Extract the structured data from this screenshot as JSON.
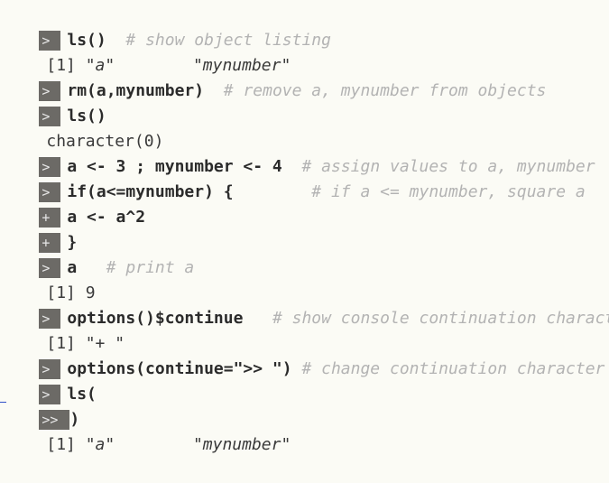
{
  "console": {
    "lines": [
      {
        "prompt": ">",
        "code": "ls()",
        "comment": "# show object listing"
      },
      {
        "output_parts": [
          "[1] ",
          "\"a\"",
          "        ",
          "\"mynumber\""
        ]
      },
      {
        "prompt": ">",
        "code": "rm(a,mynumber)",
        "comment": "# remove a, mynumber from objects"
      },
      {
        "prompt": ">",
        "code": "ls()"
      },
      {
        "output": "character(0)"
      },
      {
        "prompt": ">",
        "code": "a <- 3 ; mynumber <- 4",
        "comment": "# assign values to a, mynumber"
      },
      {
        "prompt": ">",
        "code": "if(a<=mynumber) {",
        "comment": "# if a <= mynumber, square a"
      },
      {
        "prompt": "+",
        "code": "a <- a^2"
      },
      {
        "prompt": "+",
        "code": "}"
      },
      {
        "prompt": ">",
        "code": "a",
        "comment": "# print a"
      },
      {
        "output": "[1] 9"
      },
      {
        "prompt": ">",
        "code": "options()$continue",
        "comment": "# show console continuation character"
      },
      {
        "output": "[1] \"+ \""
      },
      {
        "prompt": ">",
        "code": "options(continue=\">> \")",
        "comment": "# change continuation character"
      },
      {
        "prompt": ">",
        "code": "ls("
      },
      {
        "prompt": ">>",
        "code": ")"
      },
      {
        "output_parts": [
          "[1] ",
          "\"a\"",
          "        ",
          "\"mynumber\""
        ]
      }
    ]
  },
  "icons": {
    "wrap": "line-wrap-icon"
  },
  "colors": {
    "background": "#fbfbf5",
    "prompt_bg": "#6c6a66",
    "comment": "#b3b3b3",
    "wrap_icon": "#3050c8"
  }
}
